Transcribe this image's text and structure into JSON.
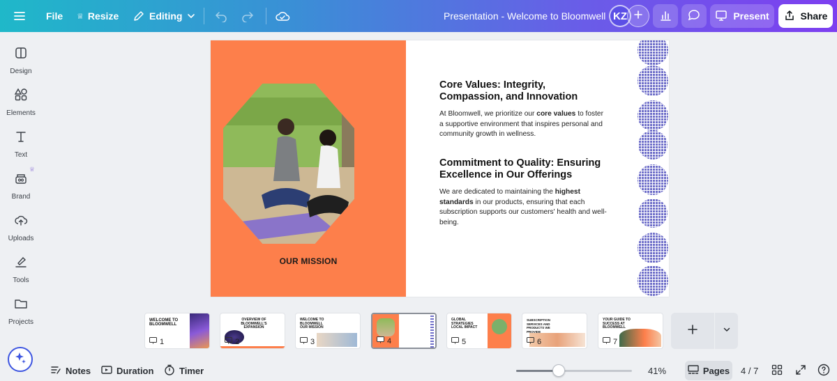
{
  "topbar": {
    "file_label": "File",
    "resize_label": "Resize",
    "editing_label": "Editing",
    "title": "Presentation - Welcome to Bloomwell",
    "avatar_initials": "KZ",
    "present_label": "Present",
    "share_label": "Share"
  },
  "sidebar": {
    "items": [
      {
        "label": "Design"
      },
      {
        "label": "Elements"
      },
      {
        "label": "Text"
      },
      {
        "label": "Brand"
      },
      {
        "label": "Uploads"
      },
      {
        "label": "Tools"
      },
      {
        "label": "Projects"
      }
    ]
  },
  "slide": {
    "mission_label": "OUR MISSION",
    "heading1": "Core Values: Integrity, Compassion, and Innovation",
    "para1_before": "At Bloomwell, we prioritize our ",
    "para1_bold": "core values",
    "para1_after": " to foster a supportive environment that inspires personal and community growth in wellness.",
    "heading2": "Commitment to Quality: Ensuring Excellence in Our Offerings",
    "para2_before": "We are dedicated to maintaining the ",
    "para2_bold": "highest standards",
    "para2_after": " in our products, ensuring that each subscription supports our customers' health and well-being."
  },
  "pages": {
    "thumbnails": [
      {
        "number": "1",
        "title": "WELCOME TO BLOOMWELL"
      },
      {
        "number": "2",
        "title": "OVERVIEW OF BLOOMWELL'S EXPANSION"
      },
      {
        "number": "3",
        "title": "WELCOME TO BLOOMWELL OUR MISSION"
      },
      {
        "number": "4",
        "title": ""
      },
      {
        "number": "5",
        "title": "GLOBAL STRATEGIES LOCAL IMPACT"
      },
      {
        "number": "6",
        "title": "SUBSCRIPTION SERVICES AND PRODUCTS WE PROVIDE"
      },
      {
        "number": "7",
        "title": "YOUR GUIDE TO SUCCESS AT BLOOMWELL"
      }
    ]
  },
  "bottombar": {
    "notes_label": "Notes",
    "duration_label": "Duration",
    "timer_label": "Timer",
    "zoom_level": "41%",
    "zoom_fraction": 0.37,
    "pages_label": "Pages",
    "page_counter": "4 / 7"
  },
  "colors": {
    "slide_accent": "#fd7f4b",
    "pattern": "#6f6fc9",
    "brand_gradient_start": "#1fb8c9",
    "brand_gradient_end": "#7d3ff0"
  }
}
